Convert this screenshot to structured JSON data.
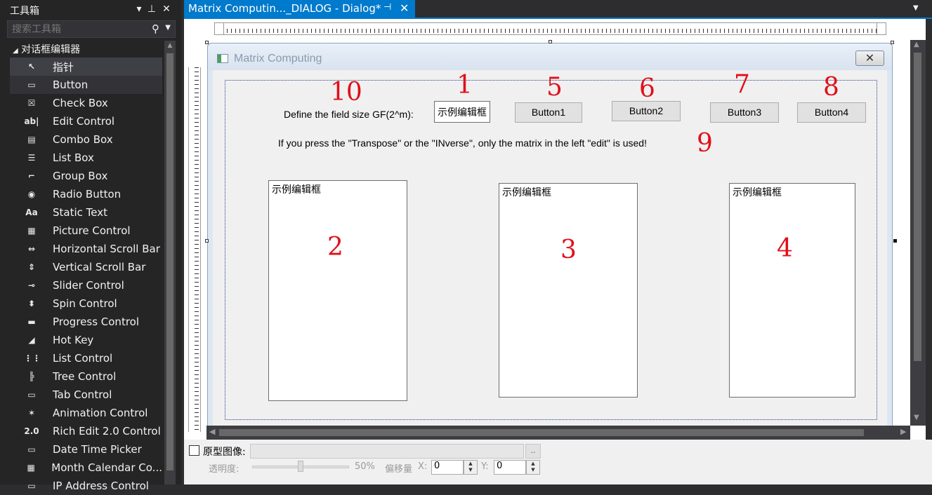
{
  "toolbox": {
    "title": "工具箱",
    "search_placeholder": "搜索工具箱",
    "group_label": "对话框编辑器",
    "items": [
      {
        "label": "指针",
        "icon": "pointer-icon",
        "glyph": "↖"
      },
      {
        "label": "Button",
        "icon": "button-icon",
        "glyph": "▭"
      },
      {
        "label": "Check Box",
        "icon": "checkbox-icon",
        "glyph": "☒"
      },
      {
        "label": "Edit Control",
        "icon": "edit-control-icon",
        "glyph": "ab|"
      },
      {
        "label": "Combo Box",
        "icon": "combo-box-icon",
        "glyph": "▤"
      },
      {
        "label": "List Box",
        "icon": "list-box-icon",
        "glyph": "☰"
      },
      {
        "label": "Group Box",
        "icon": "group-box-icon",
        "glyph": "⌐"
      },
      {
        "label": "Radio Button",
        "icon": "radio-button-icon",
        "glyph": "◉"
      },
      {
        "label": "Static Text",
        "icon": "static-text-icon",
        "glyph": "Aa"
      },
      {
        "label": "Picture Control",
        "icon": "picture-control-icon",
        "glyph": "▦"
      },
      {
        "label": "Horizontal Scroll Bar",
        "icon": "horizontal-scroll-bar-icon",
        "glyph": "⇔"
      },
      {
        "label": "Vertical Scroll Bar",
        "icon": "vertical-scroll-bar-icon",
        "glyph": "⇕"
      },
      {
        "label": "Slider Control",
        "icon": "slider-control-icon",
        "glyph": "⊸"
      },
      {
        "label": "Spin Control",
        "icon": "spin-control-icon",
        "glyph": "⬍"
      },
      {
        "label": "Progress Control",
        "icon": "progress-control-icon",
        "glyph": "▬"
      },
      {
        "label": "Hot Key",
        "icon": "hot-key-icon",
        "glyph": "◢"
      },
      {
        "label": "List Control",
        "icon": "list-control-icon",
        "glyph": "⋮⋮"
      },
      {
        "label": "Tree Control",
        "icon": "tree-control-icon",
        "glyph": "╠"
      },
      {
        "label": "Tab Control",
        "icon": "tab-control-icon",
        "glyph": "▭"
      },
      {
        "label": "Animation Control",
        "icon": "animation-control-icon",
        "glyph": "✶"
      },
      {
        "label": "Rich Edit 2.0 Control",
        "icon": "rich-edit-icon",
        "glyph": "2.0"
      },
      {
        "label": "Date Time Picker",
        "icon": "date-time-picker-icon",
        "glyph": "▭"
      },
      {
        "label": "Month Calendar Co...",
        "icon": "month-calendar-icon",
        "glyph": "▦"
      },
      {
        "label": "IP Address Control",
        "icon": "ip-address-icon",
        "glyph": "▭"
      }
    ]
  },
  "document_tab": {
    "title": "Matrix Computin..._DIALOG - Dialog*",
    "pin_icon": "pin-icon",
    "close_icon": "close-icon"
  },
  "dialog": {
    "title": "Matrix Computing",
    "close_glyph": "✕",
    "field_size_label": "Define the field size GF(2^m):",
    "field_size_edit": "示例编辑框",
    "info_text": "If you press the \"Transpose\" or the \"INverse\", only the matrix in the left \"edit\" is used!",
    "buttons": [
      "Button1",
      "Button2",
      "Button3",
      "Button4"
    ],
    "edit_left": "示例编辑框",
    "edit_middle": "示例编辑框",
    "edit_right": "示例编辑框",
    "annotations": [
      "10",
      "1",
      "5",
      "6",
      "7",
      "8",
      "9",
      "2",
      "3",
      "4"
    ],
    "annotation_color": "#e0101a"
  },
  "bottom_panel": {
    "prototype_label": "原型图像:",
    "browse_label": "..",
    "opacity_label": "透明度:",
    "opacity_value": "50%",
    "opacity_level": 0.5,
    "offset_label": "偏移量",
    "x_label": "X:",
    "x_value": "0",
    "y_label": "Y:",
    "y_value": "0"
  },
  "colors": {
    "accent": "#007acc",
    "ide_background": "#2d2d30"
  }
}
